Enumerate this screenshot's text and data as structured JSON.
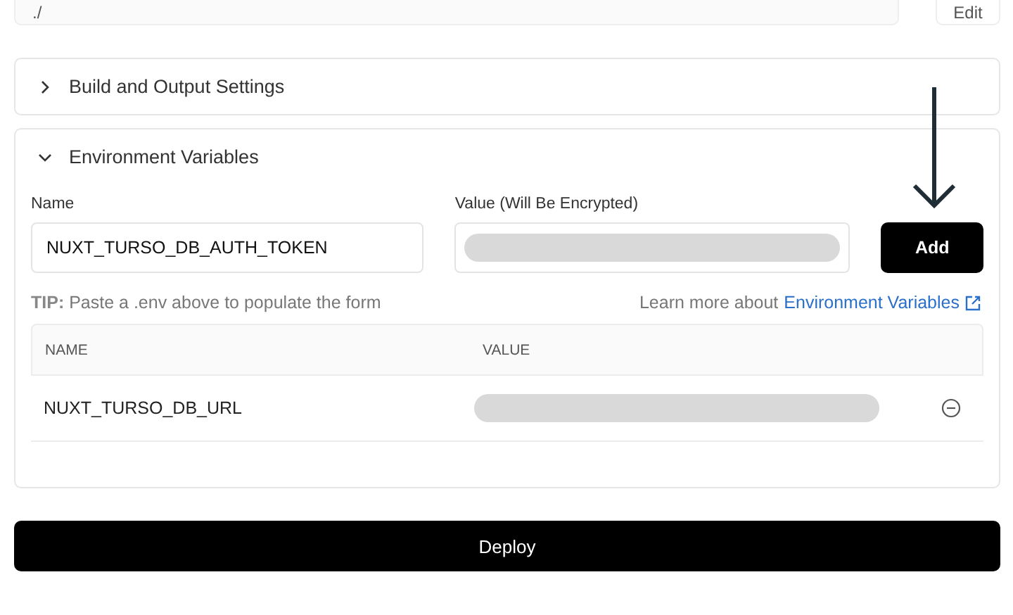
{
  "root_directory": {
    "value": "./",
    "edit_button": "Edit"
  },
  "sections": [
    {
      "title": "Build and Output Settings",
      "expanded": false
    },
    {
      "title": "Environment Variables",
      "expanded": true
    }
  ],
  "env_form": {
    "name_label": "Name",
    "name_value": "NUXT_TURSO_DB_AUTH_TOKEN",
    "value_label": "Value (Will Be Encrypted)",
    "add_button": "Add",
    "tip_label": "TIP:",
    "tip_text": "Paste a .env above to populate the form",
    "learn_more": "Learn more about",
    "learn_link": "Environment Variables"
  },
  "table": {
    "columns": [
      "NAME",
      "VALUE"
    ],
    "rows": [
      {
        "name": "NUXT_TURSO_DB_URL"
      }
    ]
  },
  "deploy_button": "Deploy"
}
